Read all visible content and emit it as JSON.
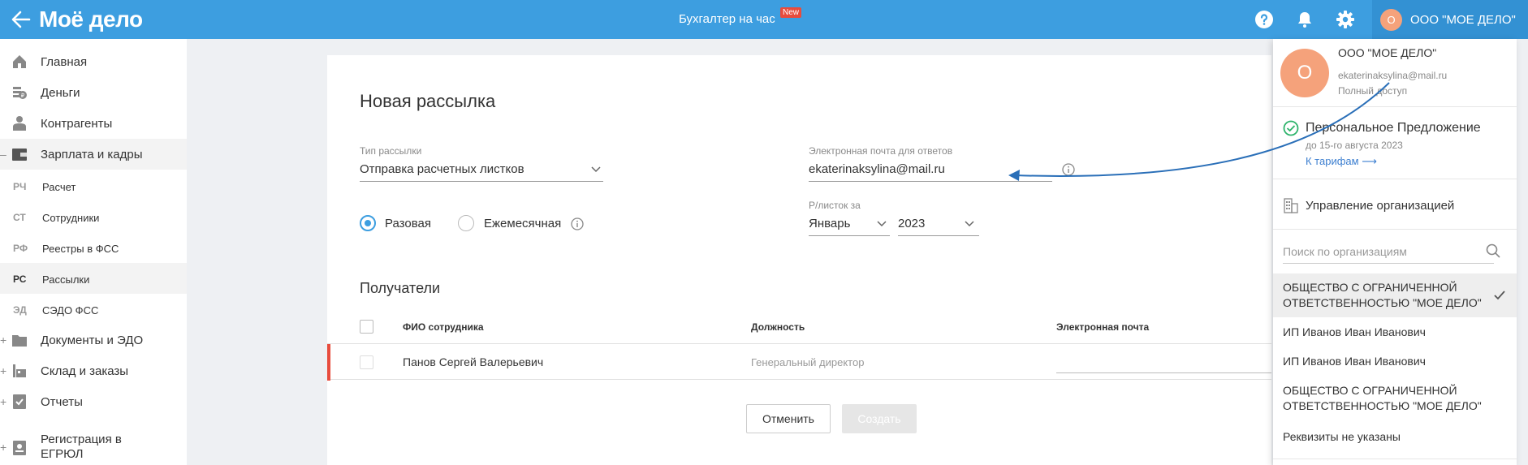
{
  "header": {
    "logo": "Моё дело",
    "center_title": "Бухгалтер на час",
    "new_badge": "New",
    "user_initial": "О",
    "user_name": "ООО \"МОЕ ДЕЛО\"",
    "icons": [
      "back-arrow-icon",
      "help-icon",
      "bell-icon",
      "gear-icon"
    ]
  },
  "sidebar": {
    "items": [
      {
        "label": "Главная",
        "icon": "home-icon"
      },
      {
        "label": "Деньги",
        "icon": "money-icon"
      },
      {
        "label": "Контрагенты",
        "icon": "contractors-icon"
      },
      {
        "label": "Зарплата и кадры",
        "icon": "wallet-icon",
        "expanded_marker": "–"
      },
      {
        "label": "Документы и ЭДО",
        "icon": "folder-icon",
        "expand_marker": "+"
      },
      {
        "label": "Склад и заказы",
        "icon": "warehouse-icon",
        "expand_marker": "+"
      },
      {
        "label": "Отчеты",
        "icon": "report-icon",
        "expand_marker": "+"
      },
      {
        "label": "Регистрация в ЕГРЮЛ",
        "icon": "registration-icon",
        "expand_marker": "+"
      }
    ],
    "subitems": [
      {
        "abbr": "РЧ",
        "label": "Расчет"
      },
      {
        "abbr": "СТ",
        "label": "Сотрудники"
      },
      {
        "abbr": "РФ",
        "label": "Реестры в ФСС"
      },
      {
        "abbr": "РС",
        "label": "Рассылки"
      },
      {
        "abbr": "ЭД",
        "label": "СЭДО ФСС"
      }
    ]
  },
  "form": {
    "title": "Новая рассылка",
    "type_label": "Тип рассылки",
    "type_value": "Отправка расчетных листков",
    "reply_email_label": "Электронная почта для ответов",
    "reply_email_value": "ekaterinaksylina@mail.ru",
    "radio_once": "Разовая",
    "radio_monthly": "Ежемесячная",
    "payslip_label": "Р/листок за",
    "month": "Январь",
    "year": "2023"
  },
  "recipients": {
    "title": "Получатели",
    "columns": [
      "ФИО сотрудника",
      "Должность",
      "Электронная почта"
    ],
    "rows": [
      {
        "name": "Панов Сергей Валерьевич",
        "position": "Генеральный директор",
        "email": ""
      }
    ]
  },
  "buttons": {
    "cancel": "Отменить",
    "create": "Создать"
  },
  "dropdown": {
    "avatar_initial": "О",
    "org": "ООО \"МОЕ ДЕЛО\"",
    "email": "ekaterinaksylina@mail.ru",
    "access": "Полный доступ",
    "offer_title": "Персональное Предложение",
    "offer_until": "до 15-го августа 2023",
    "offer_link": "К тарифам ⟶",
    "manage": "Управление организацией",
    "search_placeholder": "Поиск по организациям",
    "orgs": [
      {
        "name": "ОБЩЕСТВО С ОГРАНИЧЕННОЙ ОТВЕТСТВЕННОСТЬЮ \"МОЕ ДЕЛО\"",
        "selected": true
      },
      {
        "name": "ИП Иванов Иван Иванович",
        "selected": false
      },
      {
        "name": "ИП Иванов Иван Иванович",
        "selected": false
      },
      {
        "name": "ОБЩЕСТВО С ОГРАНИЧЕННОЙ ОТВЕТСТВЕННОСТЬЮ \"МОЕ ДЕЛО\"",
        "selected": false
      },
      {
        "name": "Реквизиты не указаны",
        "selected": false
      }
    ]
  },
  "colors": {
    "header": "#3d9ee0",
    "accent": "#3d9ee0",
    "error": "#e84c3d",
    "avatar": "#f5a27b",
    "annotation_arrow": "#2a6fb8"
  }
}
